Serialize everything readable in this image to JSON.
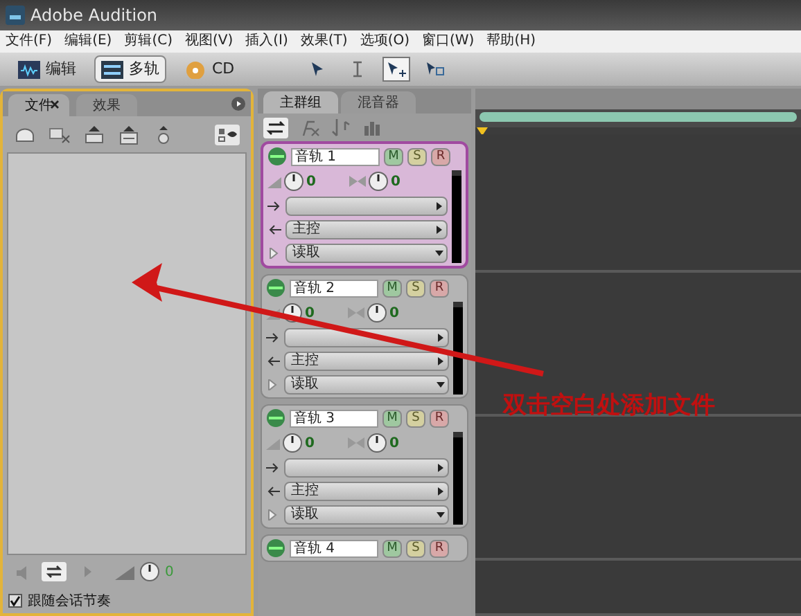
{
  "window": {
    "title": "Adobe Audition"
  },
  "menu": [
    "文件(F)",
    "编辑(E)",
    "剪辑(C)",
    "视图(V)",
    "插入(I)",
    "效果(T)",
    "选项(O)",
    "窗口(W)",
    "帮助(H)"
  ],
  "workspaces": [
    {
      "kind": "edit",
      "label": "编辑",
      "selected": false
    },
    {
      "kind": "multitrack",
      "label": "多轨",
      "selected": true
    },
    {
      "kind": "cd",
      "label": "CD",
      "selected": false
    }
  ],
  "tools": [
    {
      "kind": "move",
      "selected": false
    },
    {
      "kind": "time",
      "selected": false
    },
    {
      "kind": "hybrid",
      "selected": true
    },
    {
      "kind": "scrub",
      "selected": false
    }
  ],
  "file_panel": {
    "tabs": [
      {
        "label": "文件",
        "selected": true
      },
      {
        "label": "效果",
        "selected": false
      }
    ],
    "volume_reading": "0",
    "follow_tempo": {
      "label": "跟随会话节奏",
      "checked": true
    }
  },
  "track_panel": {
    "tabs": [
      {
        "label": "主群组",
        "selected": true
      },
      {
        "label": "混音器",
        "selected": false
      }
    ],
    "tracks": [
      {
        "name": "音轨 1",
        "selected": true,
        "buttons": [
          "M",
          "S",
          "R"
        ],
        "volume": "0",
        "pan": "0",
        "output": "主控",
        "automation": "读取"
      },
      {
        "name": "音轨 2",
        "selected": false,
        "buttons": [
          "M",
          "S",
          "R"
        ],
        "volume": "0",
        "pan": "0",
        "output": "主控",
        "automation": "读取"
      },
      {
        "name": "音轨 3",
        "selected": false,
        "buttons": [
          "M",
          "S",
          "R"
        ],
        "volume": "0",
        "pan": "0",
        "output": "主控",
        "automation": "读取"
      },
      {
        "name": "音轨 4",
        "selected": false,
        "buttons": [
          "M",
          "S",
          "R"
        ]
      }
    ]
  },
  "annotation": {
    "text": "双击空白处添加文件"
  }
}
